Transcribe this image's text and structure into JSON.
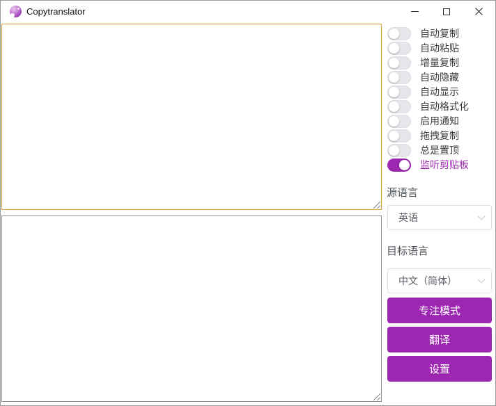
{
  "window": {
    "title": "Copytranslator"
  },
  "icons": {
    "app_logo": "purple-sphere",
    "minimize": "–",
    "maximize": "□",
    "close": "✕",
    "chevron_down": "v",
    "resize_grip": "diagonal-lines"
  },
  "toggles": [
    {
      "label": "自动复制",
      "on": false
    },
    {
      "label": "自动粘贴",
      "on": false
    },
    {
      "label": "增量复制",
      "on": false
    },
    {
      "label": "自动隐藏",
      "on": false
    },
    {
      "label": "自动显示",
      "on": false
    },
    {
      "label": "自动格式化",
      "on": false
    },
    {
      "label": "启用通知",
      "on": false
    },
    {
      "label": "拖拽复制",
      "on": false
    },
    {
      "label": "总是置顶",
      "on": false
    },
    {
      "label": "监听剪贴板",
      "on": true
    }
  ],
  "source_language": {
    "label": "源语言",
    "selected": "英语"
  },
  "target_language": {
    "label": "目标语言",
    "selected": "中文（简体）"
  },
  "action_buttons": [
    {
      "label": "专注模式"
    },
    {
      "label": "翻译"
    },
    {
      "label": "设置"
    }
  ],
  "editors": {
    "source_text": "",
    "result_text": ""
  },
  "colors": {
    "accent_purple": "#9c27b0",
    "focused_textarea_border": "#d9a43f",
    "textarea_border": "#8f8f8f",
    "toggle_off_track": "#e5e5ea",
    "select_border": "#dcdfe6"
  }
}
